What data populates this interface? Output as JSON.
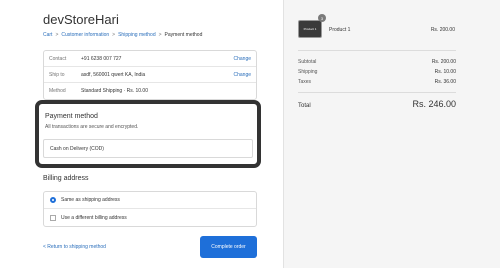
{
  "store": {
    "title": "devStoreHari"
  },
  "breadcrumb": {
    "cart": "Cart",
    "sep": ">",
    "customer_info": "Customer information",
    "shipping": "Shipping method",
    "payment": "Payment method"
  },
  "review": {
    "rows": [
      {
        "label": "Contact",
        "value": "+91 6238 007 727",
        "action": "Change"
      },
      {
        "label": "Ship to",
        "value": "asdf, 560001 qwert KA, India",
        "action": "Change"
      },
      {
        "label": "Method",
        "value": "Standard Shipping · Rs. 10.00",
        "action": ""
      }
    ]
  },
  "payment": {
    "title": "Payment method",
    "subtitle": "All transactions are secure and encrypted.",
    "option": "Cash on Delivery (COD)"
  },
  "billing": {
    "title": "Billing address",
    "same": "Same as shipping address",
    "different": "Use a different billing address"
  },
  "footer": {
    "return_label": "< Return to shipping method",
    "complete_label": "Complete order"
  },
  "order": {
    "thumb_label": "Product 1",
    "qty": "3",
    "product_name": "Product 1",
    "product_price": "Rs. 200.00",
    "subtotal_label": "Subtotal",
    "subtotal_value": "Rs. 200.00",
    "shipping_label": "Shipping",
    "shipping_value": "Rs. 10.00",
    "taxes_label": "Taxes",
    "taxes_value": "Rs. 36.00",
    "total_label": "Total",
    "total_value": "Rs. 246.00"
  },
  "colors": {
    "accent": "#1e6fd9",
    "link": "#2a6ebb",
    "highlight_border": "#333333"
  }
}
